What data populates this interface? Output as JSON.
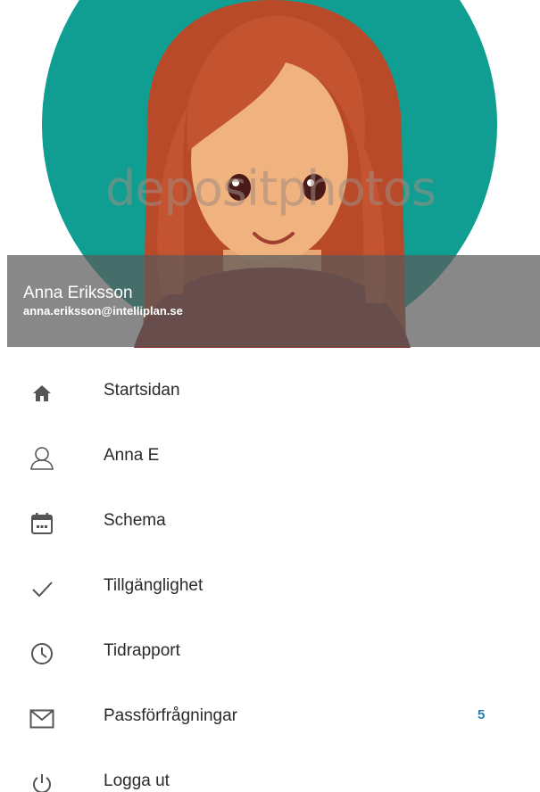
{
  "header": {
    "watermark": "depositphotos",
    "name": "Anna Eriksson",
    "email": "anna.eriksson@intelliplan.se"
  },
  "menu": {
    "items": [
      {
        "label": "Startsidan",
        "icon": "home-icon"
      },
      {
        "label": "Anna E",
        "icon": "user-icon"
      },
      {
        "label": "Schema",
        "icon": "calendar-icon"
      },
      {
        "label": "Tillgänglighet",
        "icon": "checkmark-icon"
      },
      {
        "label": "Tidrapport",
        "icon": "clock-icon"
      },
      {
        "label": "Passförfrågningar",
        "icon": "mail-icon",
        "badge": "5"
      },
      {
        "label": "Logga ut",
        "icon": "power-icon"
      }
    ]
  },
  "colors": {
    "avatar_background": "#109e92",
    "hair": "#c4532f",
    "skin": "#f0b27e",
    "badge": "#2a7fae"
  }
}
